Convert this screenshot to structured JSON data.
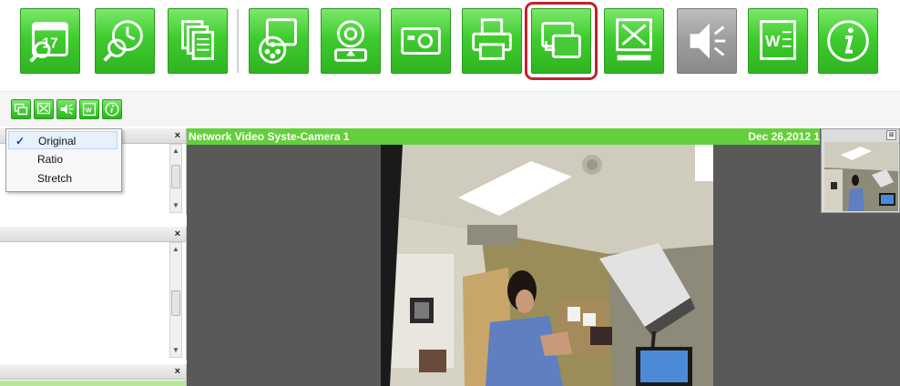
{
  "toolbar": {
    "buttons": [
      {
        "name": "schedule-search",
        "icon": "calendar-search-icon"
      },
      {
        "name": "time-search",
        "icon": "clock-search-icon"
      },
      {
        "name": "copy-files",
        "icon": "documents-icon"
      },
      {
        "name": "video-settings",
        "icon": "film-reel-icon"
      },
      {
        "name": "webcam",
        "icon": "webcam-icon"
      },
      {
        "name": "snapshot",
        "icon": "camera-icon"
      },
      {
        "name": "print",
        "icon": "printer-icon"
      },
      {
        "name": "display-mode",
        "icon": "window-resize-icon",
        "selected": true
      },
      {
        "name": "fullscreen",
        "icon": "expand-icon"
      },
      {
        "name": "audio",
        "icon": "speaker-icon",
        "disabled": true
      },
      {
        "name": "export-word",
        "icon": "word-document-icon"
      },
      {
        "name": "info",
        "icon": "info-icon"
      }
    ],
    "selected_outline_color": "#c0242c",
    "accent_color": "#3fcc2f"
  },
  "small_toolbar": {
    "buttons": [
      "window-resize-icon",
      "expand-icon",
      "speaker-icon",
      "word-document-icon",
      "info-icon"
    ]
  },
  "display_menu": {
    "items": [
      {
        "label": "Original",
        "checked": true
      },
      {
        "label": "Ratio",
        "checked": false
      },
      {
        "label": "Stretch",
        "checked": false
      }
    ],
    "check_mark": "✓"
  },
  "panels": {
    "close_glyph": "×"
  },
  "video": {
    "title": "Network Video Syste-Camera 1",
    "timestamp": "Dec 26,2012 1",
    "title_bar_color": "#64cf3c",
    "thumbnail_close_glyph": "⊠"
  }
}
